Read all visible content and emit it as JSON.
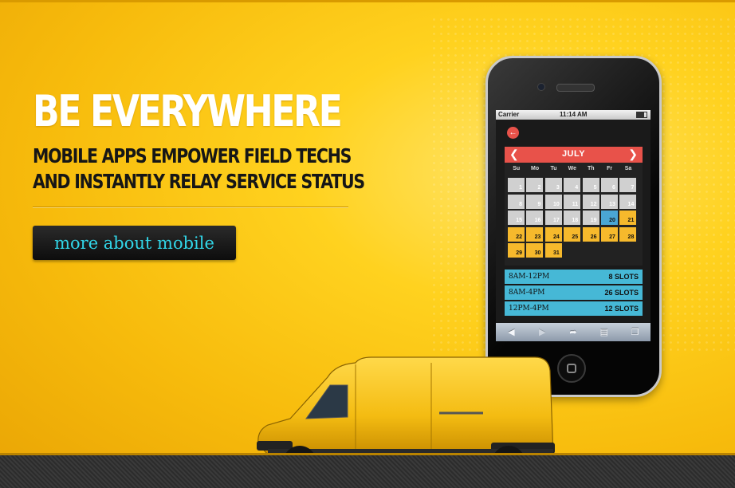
{
  "hero": {
    "headline": "BE EVERYWHERE",
    "subline_1": "MOBILE APPS EMPOWER FIELD TECHS",
    "subline_2": "AND INSTANTLY RELAY SERVICE STATUS",
    "cta_label": "more about mobile"
  },
  "phone": {
    "status": {
      "carrier": "Carrier",
      "time": "11:14 AM"
    },
    "back_icon": "back-arrow-icon",
    "calendar": {
      "month": "JULY",
      "weekdays": [
        "Su",
        "Mo",
        "Tu",
        "We",
        "Th",
        "Fr",
        "Sa"
      ],
      "selected_day": "20",
      "days": [
        "1",
        "2",
        "3",
        "4",
        "5",
        "6",
        "7",
        "8",
        "9",
        "10",
        "11",
        "12",
        "13",
        "14",
        "15",
        "16",
        "17",
        "18",
        "19",
        "20",
        "21",
        "22",
        "23",
        "24",
        "25",
        "26",
        "27",
        "28",
        "29",
        "30",
        "31"
      ]
    },
    "slots": [
      {
        "time": "8AM-12PM",
        "count": "8 SLOTS"
      },
      {
        "time": "8AM-4PM",
        "count": "26 SLOTS"
      },
      {
        "time": "12PM-4PM",
        "count": "12 SLOTS"
      }
    ],
    "toolbar_icons": [
      "back-icon",
      "forward-icon",
      "share-icon",
      "bookmarks-icon",
      "tabs-icon"
    ]
  },
  "colors": {
    "background": "#ffd21f",
    "cta_text": "#31d6e8",
    "calendar_header": "#e8524a",
    "available_day": "#f6b92c",
    "selected_day": "#4aa6d4",
    "slot_row": "#46b8d6"
  }
}
